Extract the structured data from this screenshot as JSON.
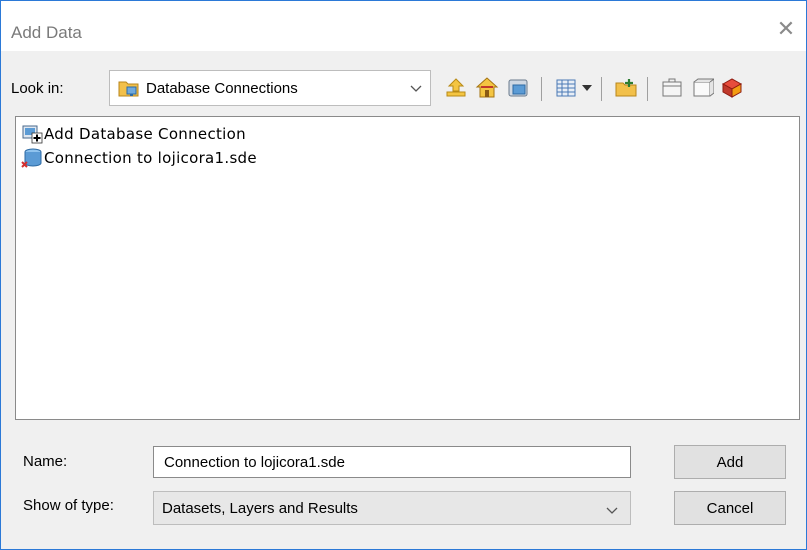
{
  "window": {
    "title": "Add Data",
    "close_glyph": "✕"
  },
  "lookin": {
    "label": "Look in:",
    "value": "Database Connections",
    "icon": "database-connections-folder-icon"
  },
  "toolbar": {
    "icons": [
      "up-one-level-icon",
      "home-icon",
      "connect-folder-icon",
      "view-options-icon",
      "view-options-dropdown-icon",
      "new-folder-icon",
      "toolbox-icon",
      "new-geodatabase-icon",
      "arc-catalog-icon"
    ]
  },
  "files": [
    {
      "label": "Add Database Connection",
      "icon": "add-database-connection-icon"
    },
    {
      "label": "Connection to lojicora1.sde",
      "icon": "sde-connection-icon"
    }
  ],
  "name": {
    "label": "Name:",
    "value": "Connection to lojicora1.sde"
  },
  "show_type": {
    "label": "Show of type:",
    "value": "Datasets, Layers and Results"
  },
  "buttons": {
    "add": "Add",
    "cancel": "Cancel"
  },
  "colors": {
    "window_border": "#2b79d7",
    "dialog_bg": "#f0f0f0",
    "folder_yellow": "#f2c04a"
  }
}
